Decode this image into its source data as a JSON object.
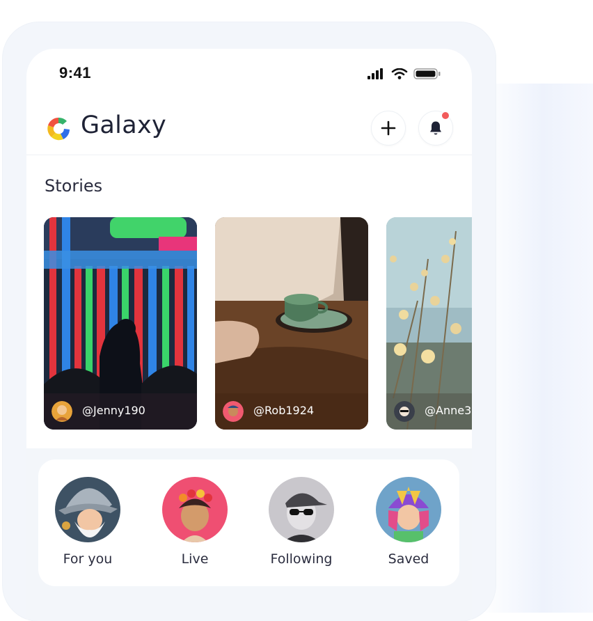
{
  "status_bar": {
    "time": "9:41",
    "signal_icon": "signal-bars-icon",
    "wifi_icon": "wifi-icon",
    "battery_icon": "battery-icon"
  },
  "header": {
    "app_name": "Galaxy",
    "logo_icon": "galaxy-logo-icon",
    "add_icon": "plus-icon",
    "notification_icon": "bell-icon"
  },
  "stories": {
    "title": "Stories",
    "items": [
      {
        "handle": "@Jenny190",
        "image": "neon-lights-silhouette"
      },
      {
        "handle": "@Rob1924",
        "image": "coffee-cup-table"
      },
      {
        "handle": "@Anne3",
        "image": "dried-flowers"
      }
    ]
  },
  "categories": [
    {
      "label": "For you",
      "avatar": "wizard-avatar"
    },
    {
      "label": "Live",
      "avatar": "flower-crown-avatar"
    },
    {
      "label": "Following",
      "avatar": "cap-sunglasses-avatar"
    },
    {
      "label": "Saved",
      "avatar": "samurai-helmet-avatar"
    }
  ],
  "colors": {
    "title": "#1e2235",
    "notification_dot": "#f25b5b",
    "screen_bg": "#f3f6fa"
  }
}
